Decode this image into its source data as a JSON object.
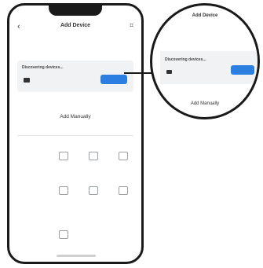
{
  "screen": {
    "title": "Add Device",
    "back_icon": "back-arrow-icon",
    "scan_icon": "scan-icon",
    "instruction": "",
    "discovering_label": "Discovering devices...",
    "go_button": "",
    "add_manually": "Add Manually",
    "categories": [
      "",
      "",
      "",
      "",
      "",
      "",
      ""
    ],
    "list_header": "",
    "devices": [
      {
        "label": ""
      },
      {
        "label": ""
      },
      {
        "label": ""
      },
      {
        "label": ""
      },
      {
        "label": ""
      },
      {
        "label": ""
      },
      {
        "label": ""
      }
    ]
  },
  "zoom": {
    "title": "Add Device",
    "instruction": "",
    "discovering_label": "Discovering devices...",
    "go_button": "",
    "add_manually": "Add Manually"
  },
  "colors": {
    "accent": "#2a7fe0",
    "frame": "#1a1a1a",
    "card": "#f1f2f4"
  }
}
